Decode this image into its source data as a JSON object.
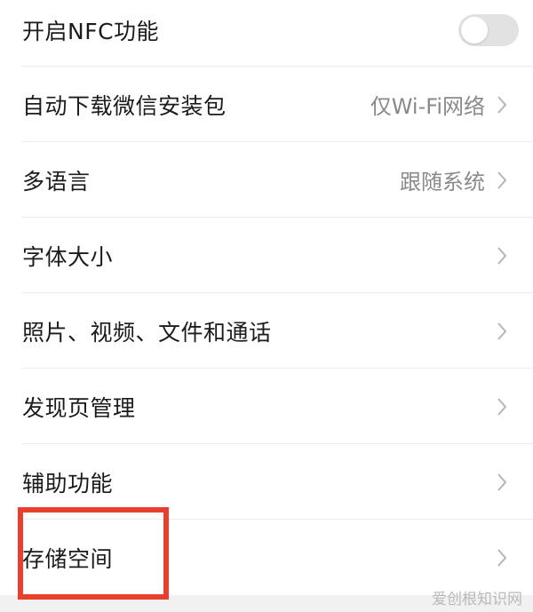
{
  "settings": {
    "nfc": {
      "label": "开启NFC功能",
      "enabled": false
    },
    "auto_download": {
      "label": "自动下载微信安装包",
      "value": "仅Wi-Fi网络"
    },
    "language": {
      "label": "多语言",
      "value": "跟随系统"
    },
    "font_size": {
      "label": "字体大小"
    },
    "media": {
      "label": "照片、视频、文件和通话"
    },
    "discover": {
      "label": "发现页管理"
    },
    "accessibility": {
      "label": "辅助功能"
    },
    "storage": {
      "label": "存储空间"
    }
  },
  "colors": {
    "highlight": "#e8402c",
    "toggle_off": "#e2e2e2",
    "chevron": "#b5b5b5"
  },
  "watermark": "爱创根知识网"
}
